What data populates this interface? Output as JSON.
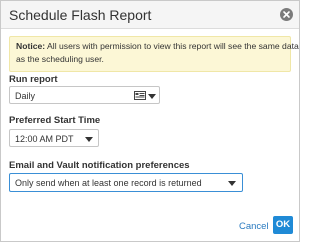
{
  "dialog": {
    "title": "Schedule Flash Report",
    "close_icon": "close-icon"
  },
  "notice": {
    "prefix": "Notice:",
    "line1": " All users with permission to view this report will see the same data",
    "line2": "as the scheduling user."
  },
  "run_report": {
    "label": "Run report",
    "value": "Daily",
    "icon": "calendar-icon"
  },
  "start_time": {
    "label": "Preferred Start Time",
    "value": "12:00 AM PDT"
  },
  "notifications": {
    "label": "Email and Vault notification preferences",
    "value": "Only send when at least one record is returned"
  },
  "footer": {
    "cancel_label": "Cancel",
    "ok_label": "OK"
  },
  "colors": {
    "notice_bg": "#fcf7d6",
    "accent": "#1f8ad6"
  }
}
